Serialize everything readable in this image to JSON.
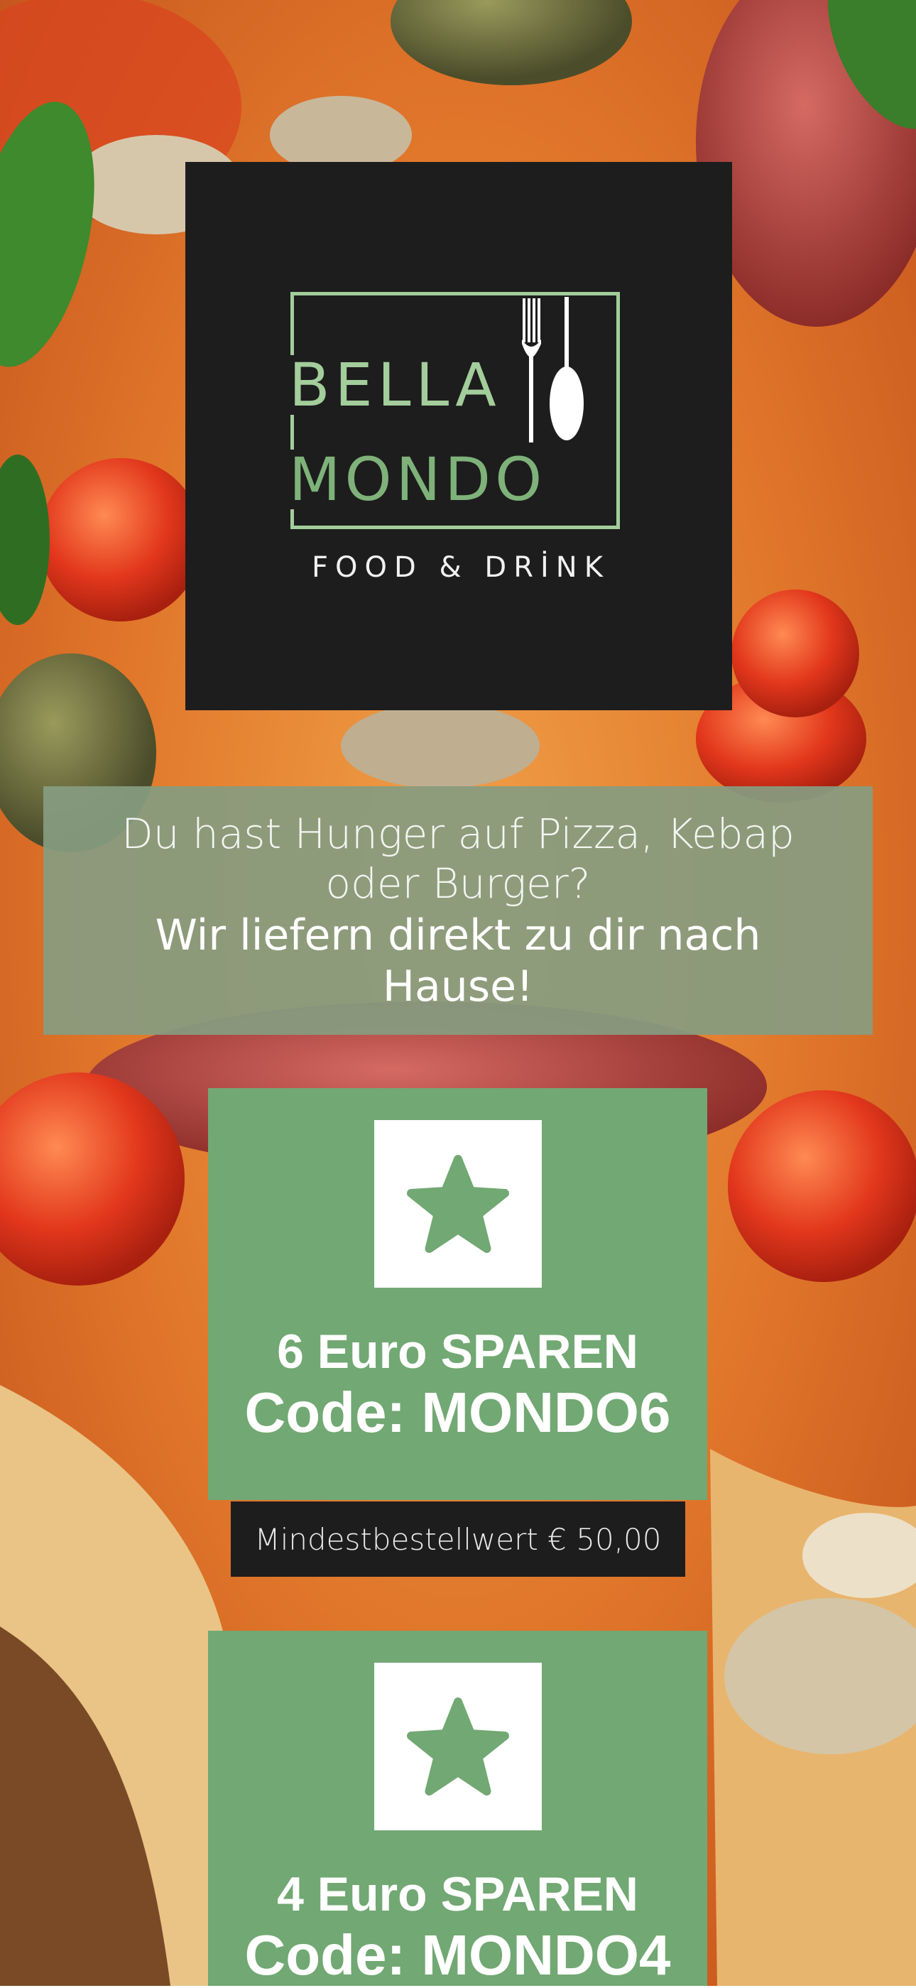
{
  "logo": {
    "brand_line1": "BELLA",
    "brand_line2": "MONDO",
    "tagline": "FOOD & DRİNK"
  },
  "headline": {
    "line1": "Du hast Hunger auf Pizza, Kebap oder Burger?",
    "line2": "Wir liefern direkt zu dir nach Hause!"
  },
  "coupons": [
    {
      "icon": "star-icon",
      "title": "6 Euro SPAREN",
      "code": "Code: MONDO6",
      "note": "Mindestbestellwert € 50,00"
    },
    {
      "icon": "star-icon",
      "title": "4 Euro SPAREN",
      "code": "Code: MONDO4"
    }
  ],
  "colors": {
    "accent_green": "#72a873",
    "logo_green_light": "#a3cd9b",
    "logo_green": "#7eb27a",
    "dark": "#1d1d1d",
    "banner": "#869c80"
  }
}
